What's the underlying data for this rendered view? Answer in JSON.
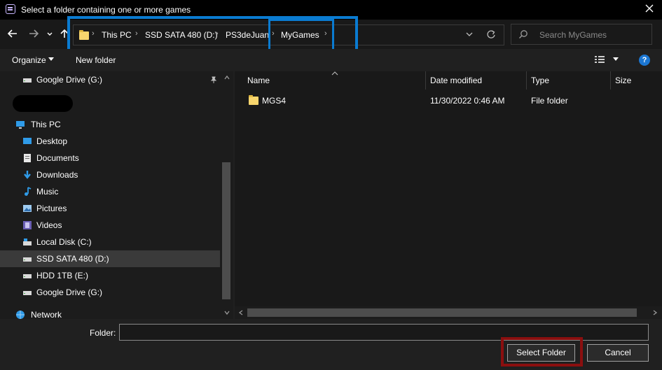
{
  "window": {
    "title": "Select a folder containing one or more games",
    "icon": "app-icon",
    "close_icon": "close-icon"
  },
  "navigation": {
    "breadcrumbs": [
      "This PC",
      "SSD SATA 480 (D:)",
      "PS3deJuan",
      "MyGames"
    ],
    "search_placeholder": "Search MyGames"
  },
  "toolbar": {
    "organize_label": "Organize",
    "new_folder_label": "New folder",
    "help_label": "?"
  },
  "sidebar": {
    "pinned_item": "Google Drive (G:)",
    "this_pc_label": "This PC",
    "items": [
      {
        "label": "Desktop",
        "icon": "desktop-icon"
      },
      {
        "label": "Documents",
        "icon": "documents-icon"
      },
      {
        "label": "Downloads",
        "icon": "downloads-icon"
      },
      {
        "label": "Music",
        "icon": "music-icon"
      },
      {
        "label": "Pictures",
        "icon": "pictures-icon"
      },
      {
        "label": "Videos",
        "icon": "videos-icon"
      },
      {
        "label": "Local Disk (C:)",
        "icon": "drive-icon"
      },
      {
        "label": "SSD SATA 480 (D:)",
        "icon": "drive-icon",
        "selected": true
      },
      {
        "label": "HDD 1TB (E:)",
        "icon": "drive-icon"
      },
      {
        "label": "Google Drive (G:)",
        "icon": "drive-icon"
      }
    ],
    "network_label": "Network"
  },
  "file_list": {
    "columns": [
      "Name",
      "Date modified",
      "Type",
      "Size"
    ],
    "rows": [
      {
        "name": "MGS4",
        "date_modified": "11/30/2022 0:46 AM",
        "type": "File folder",
        "size": ""
      }
    ]
  },
  "footer": {
    "folder_label": "Folder:",
    "folder_value": "",
    "select_button": "Select Folder",
    "cancel_button": "Cancel"
  },
  "colors": {
    "highlight_blue": "#0a7bd1",
    "highlight_red": "#8b0f0f",
    "folder_yellow": "#f7d56d"
  }
}
